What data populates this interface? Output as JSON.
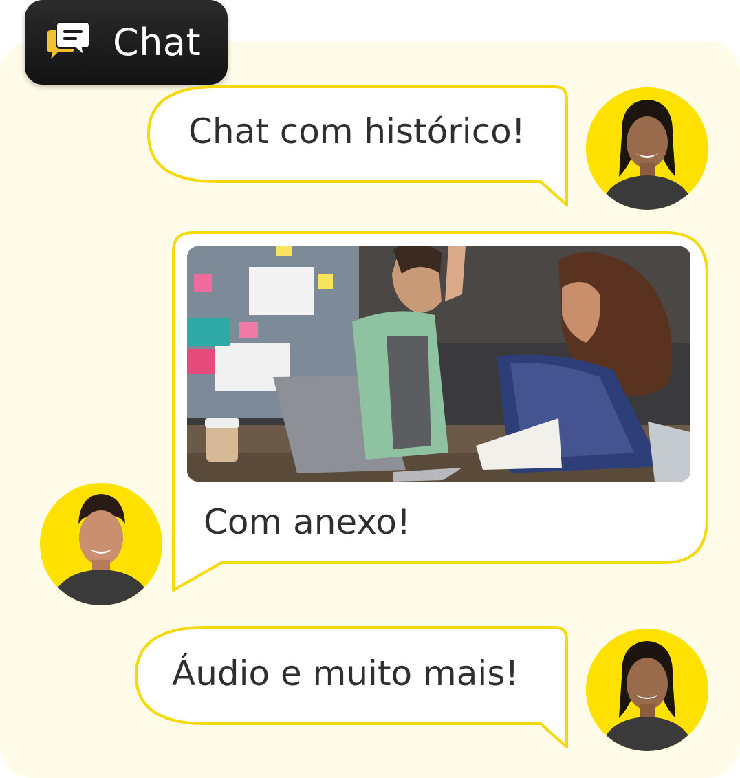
{
  "header": {
    "badge_label": "Chat",
    "icon": "chat-bubbles-icon"
  },
  "messages": [
    {
      "text": "Chat com histórico!",
      "side": "right",
      "avatar": "woman-avatar"
    },
    {
      "text": "Com anexo!",
      "side": "left",
      "avatar": "man-avatar",
      "attachment": "team-high-five-photo"
    },
    {
      "text": "Áudio e muito mais!",
      "side": "right",
      "avatar": "woman-avatar"
    }
  ],
  "colors": {
    "accent": "#ffe100",
    "bubble_border": "#f5d90a",
    "panel_bg": "#fefbe8",
    "badge_bg": "#1a1a1a",
    "text": "#2f2f2f"
  }
}
